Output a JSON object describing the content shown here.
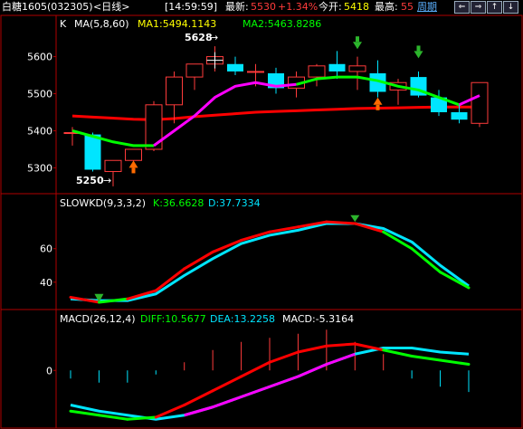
{
  "header": {
    "instrument": "白糖1605",
    "code": "(032305)",
    "period": "<日线>",
    "time": "[14:59:59]",
    "last_label": "最新:",
    "last_value": "5530",
    "change": "+1.34%",
    "open_label": "今开:",
    "open_value": "5418",
    "high_label": "最高:",
    "high_value": "55",
    "cycle_link": "周期",
    "nav": [
      "⇐",
      "⇒",
      "↑",
      "↓"
    ]
  },
  "colors": {
    "up": "#ff3b3b",
    "down": "#00e5ff",
    "ma5": "#ffffff",
    "ma8": "#ff00ff",
    "ma60": "#ff0000"
  },
  "chart_data": [
    {
      "type": "candlestick",
      "title": "K",
      "indicator": "MA(5,8,60)",
      "legend": [
        {
          "name": "MA1",
          "text": "MA1:5494.1143"
        },
        {
          "name": "MA2",
          "text": "MA2:5463.8286"
        }
      ],
      "y_ticks": [
        5300,
        5400,
        5500,
        5600
      ],
      "ylim": [
        5240,
        5660
      ],
      "annotations": {
        "high": "5628",
        "low": "5250"
      },
      "candles": [
        {
          "o": 5395,
          "h": 5410,
          "l": 5360,
          "c": 5395
        },
        {
          "o": 5390,
          "h": 5395,
          "l": 5290,
          "c": 5295
        },
        {
          "o": 5290,
          "h": 5310,
          "l": 5250,
          "c": 5320
        },
        {
          "o": 5320,
          "h": 5340,
          "l": 5290,
          "c": 5350
        },
        {
          "o": 5350,
          "h": 5480,
          "l": 5345,
          "c": 5470
        },
        {
          "o": 5470,
          "h": 5560,
          "l": 5420,
          "c": 5545
        },
        {
          "o": 5545,
          "h": 5580,
          "l": 5510,
          "c": 5580
        },
        {
          "o": 5580,
          "h": 5628,
          "l": 5560,
          "c": 5600
        },
        {
          "o": 5580,
          "h": 5600,
          "l": 5550,
          "c": 5560
        },
        {
          "o": 5560,
          "h": 5580,
          "l": 5520,
          "c": 5560
        },
        {
          "o": 5555,
          "h": 5570,
          "l": 5500,
          "c": 5515
        },
        {
          "o": 5515,
          "h": 5560,
          "l": 5490,
          "c": 5545
        },
        {
          "o": 5545,
          "h": 5580,
          "l": 5520,
          "c": 5575
        },
        {
          "o": 5580,
          "h": 5615,
          "l": 5540,
          "c": 5560
        },
        {
          "o": 5560,
          "h": 5600,
          "l": 5510,
          "c": 5575
        },
        {
          "o": 5555,
          "h": 5590,
          "l": 5490,
          "c": 5505
        },
        {
          "o": 5510,
          "h": 5540,
          "l": 5470,
          "c": 5530
        },
        {
          "o": 5545,
          "h": 5560,
          "l": 5490,
          "c": 5495
        },
        {
          "o": 5490,
          "h": 5510,
          "l": 5440,
          "c": 5450
        },
        {
          "o": 5450,
          "h": 5470,
          "l": 5420,
          "c": 5430
        },
        {
          "o": 5420,
          "h": 5530,
          "l": 5410,
          "c": 5530
        }
      ],
      "ma_short": [
        5400,
        5385,
        5370,
        5360,
        5360,
        5400,
        5440,
        5490,
        5520,
        5530,
        5520,
        5525,
        5540,
        5545,
        5545,
        5535,
        5520,
        5510,
        5490,
        5470,
        5495
      ],
      "ma_long": [
        5440,
        5437,
        5434,
        5431,
        5430,
        5433,
        5438,
        5442,
        5446,
        5450,
        5452,
        5454,
        5456,
        5458,
        5460,
        5461,
        5462,
        5463,
        5464,
        5464,
        5464
      ]
    },
    {
      "type": "line",
      "title": "SLOWKD(9,3,3,2)",
      "legend": [
        {
          "name": "K",
          "text": "K:36.6628"
        },
        {
          "name": "D",
          "text": "D:37.7334"
        }
      ],
      "y_ticks": [
        40,
        60
      ],
      "ylim": [
        28,
        82
      ],
      "series": [
        {
          "name": "K",
          "values": [
            31,
            28,
            30,
            35,
            48,
            58,
            65,
            70,
            73,
            76,
            75,
            70,
            60,
            46,
            36.66
          ]
        },
        {
          "name": "D",
          "values": [
            30,
            29,
            29,
            33,
            44,
            54,
            63,
            68,
            71,
            75,
            75,
            72,
            64,
            50,
            37.73
          ]
        }
      ]
    },
    {
      "type": "line",
      "title": "MACD(26,12,4)",
      "legend": [
        {
          "name": "DIFF",
          "text": "DIFF:10.5677"
        },
        {
          "name": "DEA",
          "text": "DEA:13.2258"
        },
        {
          "name": "MACD",
          "text": "MACD:-5.3164"
        }
      ],
      "y_ticks": [
        0
      ],
      "ylim": [
        -27,
        21
      ],
      "series": [
        {
          "name": "DIFF",
          "values": [
            -20,
            -22,
            -24,
            -23,
            -17,
            -10,
            -3,
            4,
            9,
            12,
            13,
            10,
            7,
            5,
            3
          ]
        },
        {
          "name": "DEA",
          "values": [
            -17,
            -20,
            -22,
            -24,
            -22,
            -18,
            -13,
            -8,
            -3,
            3,
            8,
            11,
            11,
            9,
            8
          ]
        }
      ],
      "histogram": [
        -2,
        -3,
        -3,
        -1,
        2,
        5,
        7,
        8,
        9,
        10,
        7,
        4,
        -2,
        -4,
        -5.3
      ]
    }
  ]
}
